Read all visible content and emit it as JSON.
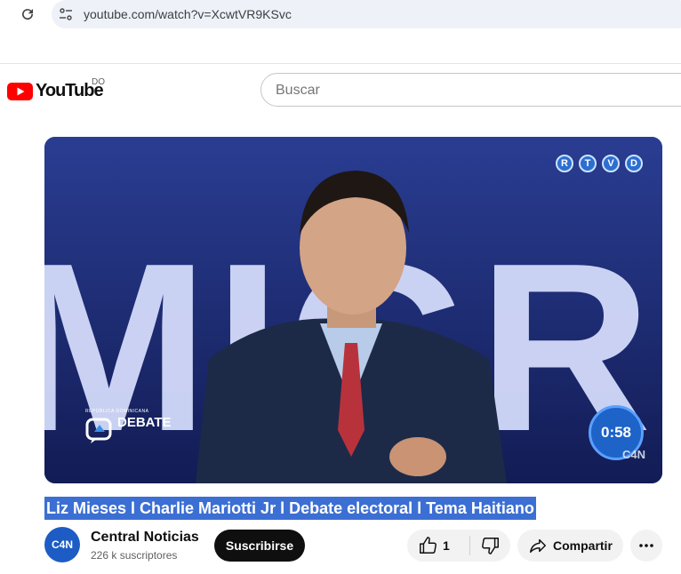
{
  "browser": {
    "url": "youtube.com/watch?v=XcwtVR9KSvc",
    "reload_icon": "reload-icon",
    "site_icon": "site-settings-icon"
  },
  "header": {
    "logo_text": "YouTube",
    "country_code": "DO",
    "search_placeholder": "Buscar"
  },
  "video": {
    "backdrop_text": "MIGRAC",
    "corner_badges": [
      "R",
      "T",
      "V",
      "D"
    ],
    "timer": "0:58",
    "debate_logo_small": "REPÚBLICA DOMINICANA",
    "debate_logo_word": "DEBATE",
    "watermark": "C4N"
  },
  "title": "Liz Mieses l Charlie Mariotti Jr l Debate electoral l Tema Haitiano",
  "channel": {
    "avatar_text": "C4N",
    "name": "Central Noticias",
    "subscribers": "226 k suscriptores",
    "subscribe_label": "Suscribirse"
  },
  "actions": {
    "like_count": "1",
    "share_label": "Compartir"
  },
  "colors": {
    "youtube_red": "#ff0000",
    "title_highlight": "#3c6fd3",
    "subscribe_bg": "#0f0f0f"
  }
}
